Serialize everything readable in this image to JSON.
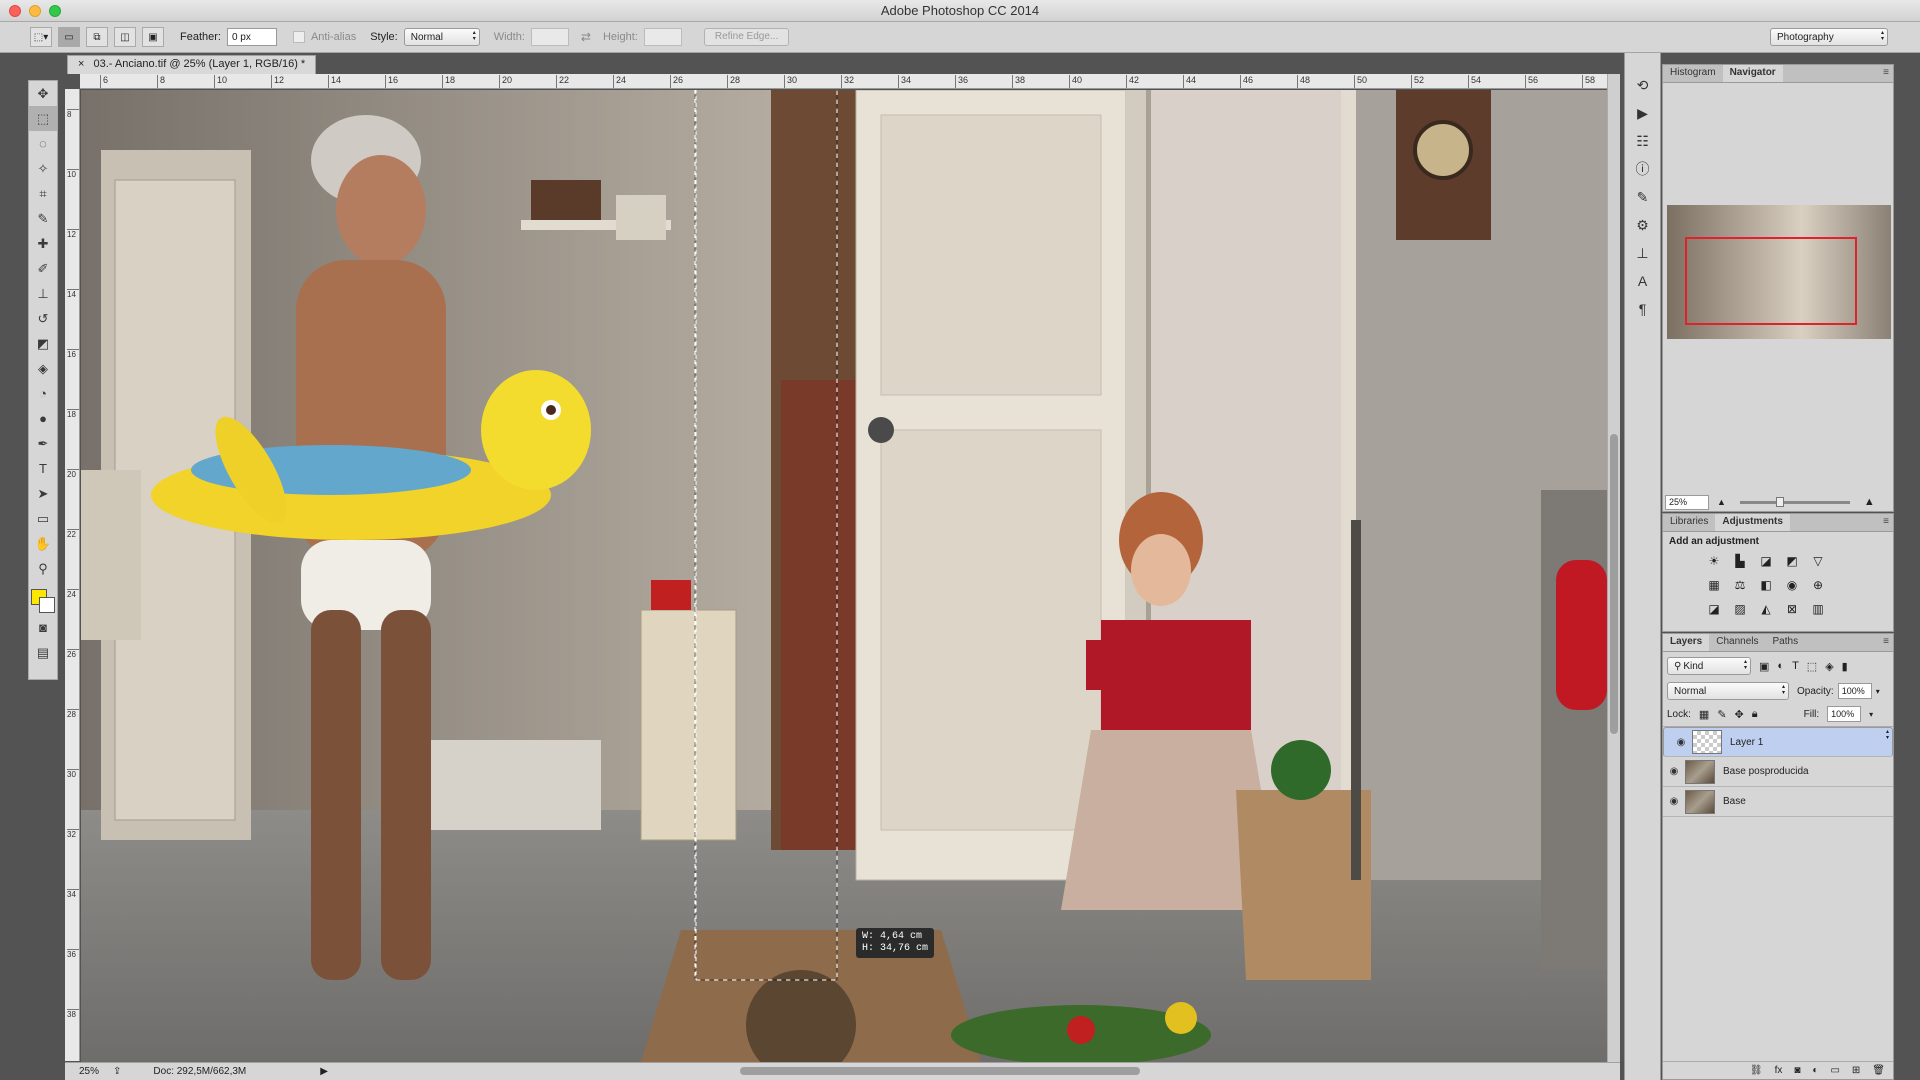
{
  "app": {
    "title": "Adobe Photoshop CC 2014"
  },
  "options": {
    "feather_label": "Feather:",
    "feather_value": "0 px",
    "antialias_label": "Anti-alias",
    "style_label": "Style:",
    "style_value": "Normal",
    "width_label": "Width:",
    "height_label": "Height:",
    "refine_label": "Refine Edge...",
    "workspace": "Photography"
  },
  "document": {
    "tab_title": "03.- Anciano.tif @ 25% (Layer 1, RGB/16) *",
    "zoom": "25%",
    "doc_info": "Doc: 292,5M/662,3M",
    "selection_w": "W:  4,64 cm",
    "selection_h": "H: 34,76 cm"
  },
  "rulers": {
    "h_ticks": [
      "6",
      "8",
      "10",
      "12",
      "14",
      "16",
      "18",
      "20",
      "22",
      "24",
      "26",
      "28",
      "30",
      "32",
      "34",
      "36",
      "38",
      "40",
      "42",
      "44",
      "46",
      "48",
      "50",
      "52",
      "54",
      "56",
      "58"
    ],
    "v_ticks": [
      "8",
      "10",
      "12",
      "14",
      "16",
      "18",
      "20",
      "22",
      "24",
      "26",
      "28",
      "30",
      "32",
      "34",
      "36",
      "38"
    ]
  },
  "navigator": {
    "tabs": [
      "Histogram",
      "Navigator"
    ],
    "active": "Navigator",
    "zoom": "25%"
  },
  "adjustments": {
    "tabs": [
      "Libraries",
      "Adjustments"
    ],
    "active": "Adjustments",
    "header": "Add an adjustment"
  },
  "layers_panel": {
    "tabs": [
      "Layers",
      "Channels",
      "Paths"
    ],
    "active": "Layers",
    "filter": "Kind",
    "blend": "Normal",
    "opacity_label": "Opacity:",
    "opacity": "100%",
    "lock_label": "Lock:",
    "fill_label": "Fill:",
    "fill": "100%",
    "layers": [
      {
        "name": "Layer 1",
        "selected": true
      },
      {
        "name": "Base posproducida",
        "selected": false
      },
      {
        "name": "Base",
        "selected": false
      }
    ]
  },
  "colors": {
    "foreground": "#ffe600",
    "background": "#ffffff",
    "selection_highlight": "#bfcff0",
    "nav_view_box": "#e0222a"
  }
}
